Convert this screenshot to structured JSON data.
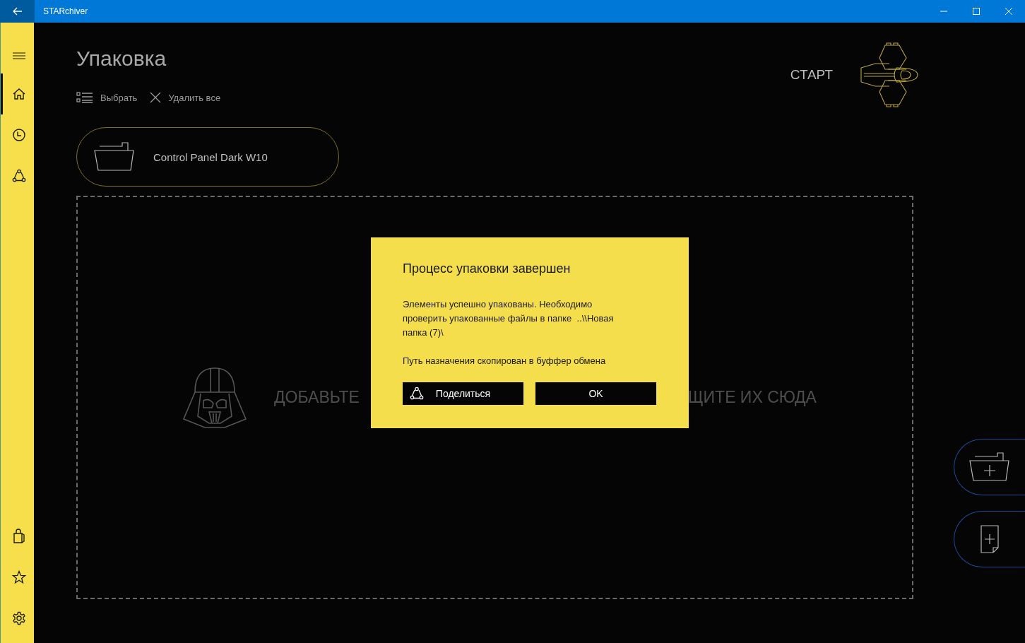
{
  "window": {
    "title": "STARchiver"
  },
  "sidebar": {
    "top": [
      {
        "kind": "home",
        "selected": true
      },
      {
        "kind": "history",
        "selected": false
      },
      {
        "kind": "share",
        "selected": false
      }
    ],
    "bottom": [
      {
        "kind": "store",
        "selected": false
      },
      {
        "kind": "favorites",
        "selected": false
      },
      {
        "kind": "settings",
        "selected": false
      }
    ]
  },
  "page": {
    "title": "Упаковка",
    "toolbar": [
      {
        "kind": "select",
        "label": "Выбрать"
      },
      {
        "kind": "clear",
        "label": "Удалить все"
      }
    ],
    "start_label": "СТАРТ",
    "files": [
      {
        "name": "Control Panel Dark W10"
      }
    ],
    "drop_zone": {
      "text_left": "ДОБАВЬТЕ",
      "text_right": "ЩИТЕ ИХ СЮДА"
    },
    "actions": [
      {
        "kind": "add-folder"
      },
      {
        "kind": "add-file"
      }
    ]
  },
  "dialog": {
    "title": "Процесс упаковки завершен",
    "paragraphs": [
      "Элементы успешно упакованы. Необходимо проверить упакованные файлы в папке  ..\\\\Новая папка (7)\\",
      "Путь назначения скопирован в буффер обмена"
    ],
    "buttons": [
      {
        "kind": "share",
        "label": "Поделиться"
      },
      {
        "kind": "ok",
        "label": "OK"
      }
    ]
  }
}
